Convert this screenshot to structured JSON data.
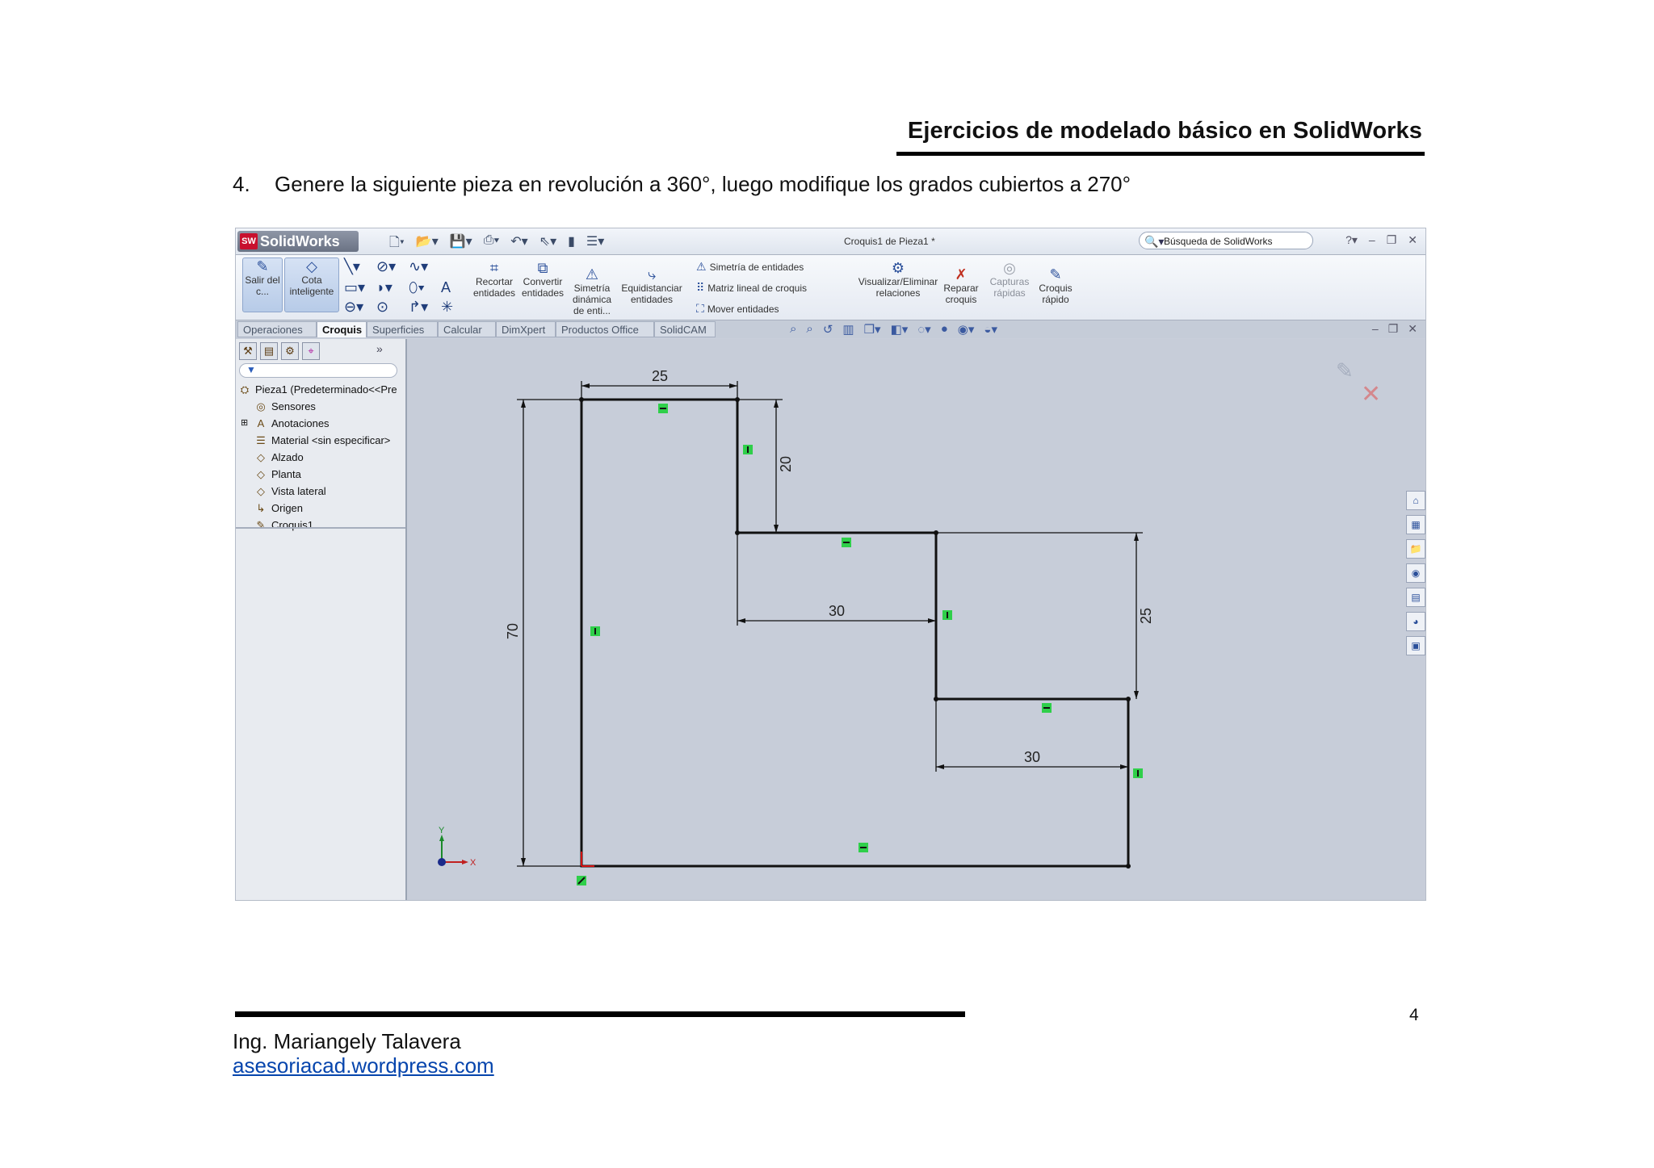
{
  "header": {
    "title": "Ejercicios de modelado básico en SolidWorks"
  },
  "exercise": {
    "number": "4.",
    "text": "Genere la siguiente pieza en revolución a 360°,  luego modifique los grados cubiertos a 270°"
  },
  "solidworks": {
    "logo": "SolidWorks",
    "window_title": "Croquis1 de Pieza1 *",
    "search_placeholder": "Búsqueda de SolidWorks",
    "ribbon": {
      "exit_sketch": "Salir del c...",
      "smart_dimension": "Cota inteligente",
      "trim": "Recortar entidades",
      "convert": "Convertir entidades",
      "dynamic_mirror": "Simetría dinámica de enti...",
      "offset": "Equidistanciar entidades",
      "mirror_entities": "Simetría de entidades",
      "linear_pattern": "Matriz lineal de croquis",
      "move_entities": "Mover entidades",
      "relations": "Visualizar/Eliminar relaciones",
      "repair_sketch": "Reparar croquis",
      "quick_snaps": "Capturas rápidas",
      "rapid_sketch": "Croquis rápido"
    },
    "tabs": [
      "Operaciones",
      "Croquis",
      "Superficies",
      "Calcular",
      "DimXpert",
      "Productos Office",
      "SolidCAM"
    ],
    "active_tab": "Croquis",
    "tree": [
      "Pieza1  (Predeterminado<<Pre",
      "Sensores",
      "Anotaciones",
      "Material <sin especificar>",
      "Alzado",
      "Planta",
      "Vista lateral",
      "Origen",
      "Croquis1"
    ],
    "dimensions": {
      "top_width": "25",
      "top_step_height": "20",
      "mid_width": "30",
      "mid_step_height": "25",
      "bottom_width": "30",
      "total_height": "70"
    },
    "axis_labels": {
      "x": "X",
      "y": "Y"
    }
  },
  "footer": {
    "page_number": "4",
    "author": "Ing. Mariangely Talavera",
    "website": "asesoriacad.wordpress.com"
  }
}
